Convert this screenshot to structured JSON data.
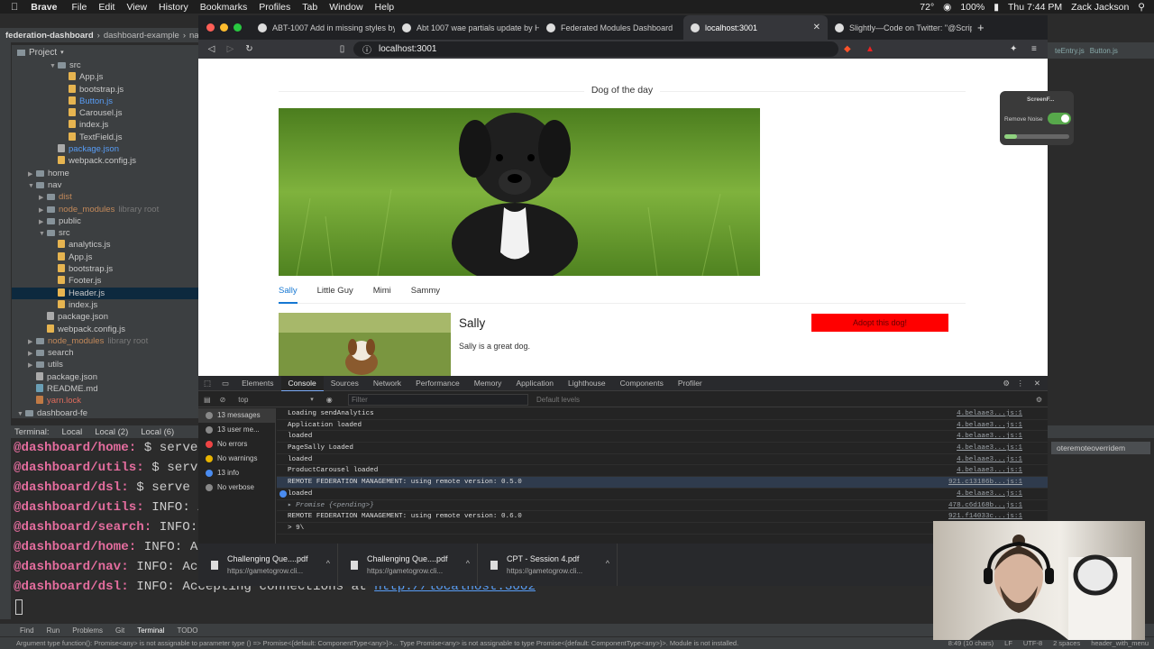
{
  "menubar": {
    "app": "Brave",
    "items": [
      "File",
      "Edit",
      "View",
      "History",
      "Bookmarks",
      "Profiles",
      "Tab",
      "Window",
      "Help"
    ],
    "battery": "100%",
    "clock": "Thu 7:44 PM",
    "user": "Zack Jackson",
    "temp": "72°"
  },
  "ide": {
    "breadcrumb": [
      "federation-dashboard",
      "dashboard-example",
      "nav"
    ],
    "project_label": "Project",
    "tree": [
      {
        "depth": 3,
        "type": "folder",
        "open": true,
        "label": "src"
      },
      {
        "depth": 4,
        "type": "file",
        "label": "App.js"
      },
      {
        "depth": 4,
        "type": "file",
        "label": "bootstrap.js"
      },
      {
        "depth": 4,
        "type": "file",
        "label": "Button.js",
        "cls": "blue"
      },
      {
        "depth": 4,
        "type": "file",
        "label": "Carousel.js"
      },
      {
        "depth": 4,
        "type": "file",
        "label": "index.js"
      },
      {
        "depth": 4,
        "type": "file",
        "label": "TextField.js"
      },
      {
        "depth": 3,
        "type": "json",
        "label": "package.json",
        "cls": "blue"
      },
      {
        "depth": 3,
        "type": "file",
        "label": "webpack.config.js"
      },
      {
        "depth": 1,
        "type": "folder",
        "open": false,
        "label": "home"
      },
      {
        "depth": 1,
        "type": "folder",
        "open": true,
        "label": "nav"
      },
      {
        "depth": 2,
        "type": "folder",
        "open": false,
        "label": "dist",
        "cls": "ignored"
      },
      {
        "depth": 2,
        "type": "folder",
        "open": false,
        "label": "node_modules",
        "cls": "ignored",
        "extra": "library root"
      },
      {
        "depth": 2,
        "type": "folder",
        "open": false,
        "label": "public"
      },
      {
        "depth": 2,
        "type": "folder",
        "open": true,
        "label": "src"
      },
      {
        "depth": 3,
        "type": "file",
        "label": "analytics.js"
      },
      {
        "depth": 3,
        "type": "file",
        "label": "App.js"
      },
      {
        "depth": 3,
        "type": "file",
        "label": "bootstrap.js"
      },
      {
        "depth": 3,
        "type": "file",
        "label": "Footer.js"
      },
      {
        "depth": 3,
        "type": "file",
        "label": "Header.js",
        "sel": true
      },
      {
        "depth": 3,
        "type": "file",
        "label": "index.js"
      },
      {
        "depth": 2,
        "type": "json",
        "label": "package.json"
      },
      {
        "depth": 2,
        "type": "file",
        "label": "webpack.config.js"
      },
      {
        "depth": 1,
        "type": "folder",
        "open": false,
        "label": "node_modules",
        "cls": "ignored",
        "extra": "library root"
      },
      {
        "depth": 1,
        "type": "folder",
        "open": false,
        "label": "search"
      },
      {
        "depth": 1,
        "type": "folder",
        "open": false,
        "label": "utils"
      },
      {
        "depth": 1,
        "type": "json",
        "label": "package.json"
      },
      {
        "depth": 1,
        "type": "md",
        "label": "README.md"
      },
      {
        "depth": 1,
        "type": "lock",
        "label": "yarn.lock",
        "cls": "red"
      },
      {
        "depth": 0,
        "type": "folder",
        "open": true,
        "label": "dashboard-fe"
      }
    ],
    "terminal_tabs": [
      "Terminal:",
      "Local",
      "Local (2)",
      "Local (6)"
    ],
    "terminal_lines": [
      {
        "who": "@dashboard/home:",
        "text": " $ serve di",
        "link": ""
      },
      {
        "who": "@dashboard/utils:",
        "text": " $ serve d",
        "link": ""
      },
      {
        "who": "@dashboard/dsl:",
        "text": " $ serve di",
        "link": ""
      },
      {
        "who": "@dashboard/utils:",
        "text": " INFO: Ac",
        "link": ""
      },
      {
        "who": "@dashboard/search:",
        "text": " INFO: A",
        "link": ""
      },
      {
        "who": "@dashboard/home:",
        "text": " INFO: Acc",
        "link": ""
      },
      {
        "who": "@dashboard/nav:",
        "text": " INFO: Acc",
        "link": ""
      },
      {
        "who": "@dashboard/dsl:",
        "text": " INFO: Accepting connections at ",
        "link": "http://localhost:3002"
      }
    ],
    "bottom_tools": [
      "Find",
      "Run",
      "Problems",
      "Git",
      "Terminal",
      "TODO"
    ],
    "status_msg": "Argument type function(): Promise<any> is not assignable to parameter type () => Promise<{default: ComponentType<any>}>... Type Promise<any> is not assignable to type Promise<{default: ComponentType<any>}>. Module is not installed.",
    "status_right": [
      "8:49 (10 chars)",
      "LF",
      "UTF-8",
      "2 spaces",
      "header_with_menu"
    ],
    "right_tabs": [
      "teEntry.js",
      "Button.js"
    ],
    "right_term_tab": "oteremoteoverridem"
  },
  "browser": {
    "tabs": [
      {
        "label": "ABT-1007 Add in missing styles by",
        "active": false
      },
      {
        "label": "Abt 1007 wae partials update by Hi",
        "active": false
      },
      {
        "label": "Federated Modules Dashboard",
        "active": false
      },
      {
        "label": "localhost:3001",
        "active": true
      },
      {
        "label": "Slightly—Code on Twitter: \"@Script",
        "active": false
      }
    ],
    "url": "localhost:3001",
    "page": {
      "title": "Dog of the day",
      "dog_tabs": [
        "Sally",
        "Little Guy",
        "Mimi",
        "Sammy"
      ],
      "card_name": "Sally",
      "card_desc": "Sally is a great dog.",
      "adopt_label": "Adopt this dog!"
    }
  },
  "devtools": {
    "tabs": [
      "Elements",
      "Console",
      "Sources",
      "Network",
      "Performance",
      "Memory",
      "Application",
      "Lighthouse",
      "Components",
      "Profiler"
    ],
    "active_tab": "Console",
    "context": "top",
    "filter_placeholder": "Filter",
    "levels": "Default levels",
    "sidebar": [
      {
        "label": "13 messages",
        "color": "#888"
      },
      {
        "label": "13 user me...",
        "color": "#888"
      },
      {
        "label": "No errors",
        "color": "#e44"
      },
      {
        "label": "No warnings",
        "color": "#e8b400"
      },
      {
        "label": "13 info",
        "color": "#4a8cf0"
      },
      {
        "label": "No verbose",
        "color": "#888"
      }
    ],
    "logs": [
      {
        "msg": "Loading sendAnalytics",
        "src": "4.belaae3...js:1"
      },
      {
        "msg": "Application loaded",
        "src": "4.belaae3...js:1"
      },
      {
        "msg": "loaded",
        "src": "4.belaae3...js:1"
      },
      {
        "msg": "PageSally Loaded",
        "src": "4.belaae3...js:1"
      },
      {
        "msg": "loaded",
        "src": "4.belaae3...js:1"
      },
      {
        "msg": "ProductCarousel loaded",
        "src": "4.belaae3...js:1"
      },
      {
        "msg": "REMOTE FEDERATION MANAGEMENT: using remote version: 0.5.0",
        "src": "921.c13186b...js:1",
        "hl": true
      },
      {
        "msg": "loaded",
        "src": "4.belaae3...js:1",
        "info": true
      },
      {
        "msg": "▸ Promise {<pending>}",
        "src": "478.c6d168b...js:1",
        "pend": true
      },
      {
        "msg": "REMOTE FEDERATION MANAGEMENT: using remote version: 0.6.0",
        "src": "921.f14033c...js:1"
      },
      {
        "msg": "> 9\\",
        "src": ""
      }
    ]
  },
  "downloads": [
    {
      "name": "Challenging Que....pdf",
      "url": "https://gametogrow.cli..."
    },
    {
      "name": "Challenging Que....pdf",
      "url": "https://gametogrow.cli..."
    },
    {
      "name": "CPT - Session 4.pdf",
      "url": "https://gametogrow.cli..."
    }
  ],
  "widget": {
    "title": "ScreenF...",
    "toggle_label": "Remove Noise"
  }
}
